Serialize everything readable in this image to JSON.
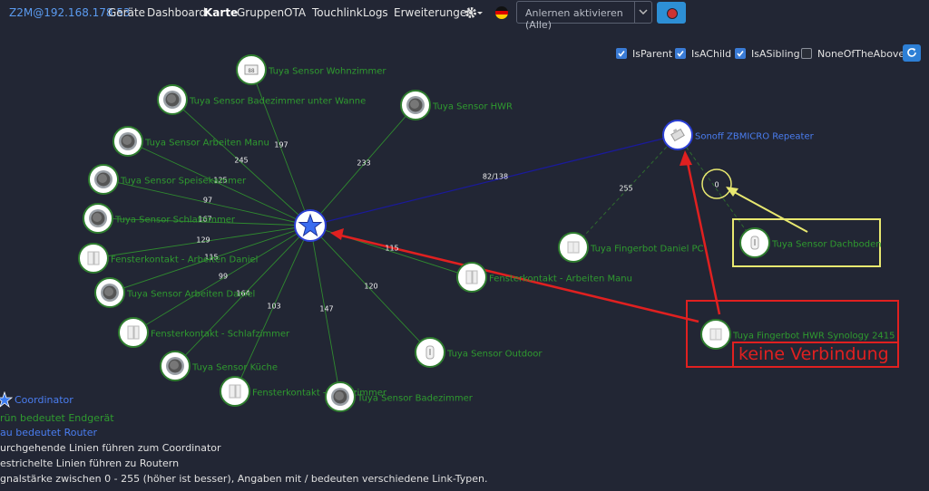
{
  "nav": {
    "brand": "Z2M@192.168.178.53",
    "items": [
      "Geräte",
      "Dashboard",
      "Karte",
      "Gruppen",
      "OTA",
      "Touchlink",
      "Logs",
      "Erweiterungen"
    ],
    "active_index": 2,
    "language_flag": "german-flag",
    "permit_join_select": "Anlernen aktivieren (Alle)",
    "theme_button_icon": "palette-icon"
  },
  "filters": {
    "checkboxes": [
      {
        "label": "IsParent",
        "checked": true
      },
      {
        "label": "IsAChild",
        "checked": true
      },
      {
        "label": "IsASibling",
        "checked": true
      },
      {
        "label": "NoneOfTheAbove",
        "checked": false
      }
    ],
    "refresh_icon": "refresh-icon"
  },
  "map": {
    "nodes": {
      "coordinator": {
        "label": "",
        "type": "coordinator"
      },
      "wohnzimmer": {
        "label": "Tuya Sensor Wohnzimmer",
        "type": "end"
      },
      "badezimmer_wanne": {
        "label": "Tuya Sensor Badezimmer unter Wanne",
        "type": "end"
      },
      "hwr": {
        "label": "Tuya Sensor HWR",
        "type": "end"
      },
      "arbeiten_manu": {
        "label": "Tuya Sensor Arbeiten Manu",
        "type": "end"
      },
      "speisekammer": {
        "label": "Tuya Sensor Speisekammer",
        "type": "end"
      },
      "schlafzimmer": {
        "label": "Tuya Sensor Schlafzimmer",
        "type": "end"
      },
      "fk_arbeiten_daniel": {
        "label": "Fensterkontakt - Arbeiten Daniel",
        "type": "end"
      },
      "arbeiten_daniel": {
        "label": "Tuya Sensor Arbeiten Daniel",
        "type": "end"
      },
      "fk_schlafzimmer": {
        "label": "Fensterkontakt - Schlafzimmer",
        "type": "end"
      },
      "kueche": {
        "label": "Tuya Sensor Küche",
        "type": "end"
      },
      "fk_badezimmer": {
        "label": "Fensterkontakt - Badezimmer",
        "type": "end"
      },
      "badezimmer": {
        "label": "Tuya Sensor Badezimmer",
        "type": "end"
      },
      "outdoor": {
        "label": "Tuya Sensor Outdoor",
        "type": "end"
      },
      "fk_arbeiten_manu": {
        "label": "Fensterkontakt - Arbeiten Manu",
        "type": "end"
      },
      "repeater": {
        "label": "Sonoff ZBMICRO Repeater",
        "type": "router"
      },
      "fingerbot_daniel": {
        "label": "Tuya Fingerbot Daniel PC",
        "type": "end"
      },
      "dachboden": {
        "label": "Tuya Sensor Dachboden",
        "type": "end"
      },
      "fingerbot_hwr": {
        "label": "Tuya Fingerbot HWR Synology 2415",
        "type": "end"
      }
    },
    "links": [
      {
        "from": "wohnzimmer",
        "to": "coordinator",
        "lqi": "197",
        "style": "solid"
      },
      {
        "from": "badezimmer_wanne",
        "to": "coordinator",
        "lqi": "245",
        "style": "solid"
      },
      {
        "from": "hwr",
        "to": "coordinator",
        "lqi": "233",
        "style": "solid"
      },
      {
        "from": "arbeiten_manu",
        "to": "coordinator",
        "lqi": "125",
        "style": "solid"
      },
      {
        "from": "speisekammer",
        "to": "coordinator",
        "lqi": "97",
        "style": "solid"
      },
      {
        "from": "schlafzimmer",
        "to": "coordinator",
        "lqi": "167",
        "style": "solid"
      },
      {
        "from": "fk_arbeiten_daniel",
        "to": "coordinator",
        "lqi": "129",
        "style": "solid"
      },
      {
        "from": "arbeiten_daniel",
        "to": "coordinator",
        "lqi": "115",
        "style": "solid"
      },
      {
        "from": "fk_schlafzimmer",
        "to": "coordinator",
        "lqi": "99",
        "style": "solid"
      },
      {
        "from": "kueche",
        "to": "coordinator",
        "lqi": "164",
        "style": "solid"
      },
      {
        "from": "fk_badezimmer",
        "to": "coordinator",
        "lqi": "103",
        "style": "solid"
      },
      {
        "from": "badezimmer",
        "to": "coordinator",
        "lqi": "147",
        "style": "solid"
      },
      {
        "from": "outdoor",
        "to": "coordinator",
        "lqi": "120",
        "style": "solid"
      },
      {
        "from": "fk_arbeiten_manu",
        "to": "coordinator",
        "lqi": "115",
        "style": "solid"
      },
      {
        "from": "repeater",
        "to": "coordinator",
        "lqi": "82/138",
        "style": "router"
      },
      {
        "from": "fingerbot_daniel",
        "to": "repeater",
        "lqi": "255",
        "style": "dashed"
      },
      {
        "from": "dachboden",
        "to": "repeater",
        "lqi": "0",
        "style": "dashed"
      }
    ]
  },
  "annotations": {
    "keine_verbindung": "keine Verbindung"
  },
  "legend": {
    "coordinator": "Coordinator",
    "green": "rün bedeutet Endgerät",
    "blue": "au bedeutet Router",
    "solid": "urchgehende Linien führen zum Coordinator",
    "dashed": "estrichelte Linien führen zu Routern",
    "strength": "gnalstärke zwischen 0 - 255 (höher ist besser), Angaben mit / bedeuten verschiedene Link-Typen."
  },
  "colors": {
    "background": "#222634",
    "end_device_label": "#2f9b2f",
    "router_label": "#4a7df0",
    "router_link": "#1a1a9a",
    "annotation_red": "#e02020",
    "annotation_yellow": "#e8e870",
    "brand": "#5b9bf0"
  }
}
